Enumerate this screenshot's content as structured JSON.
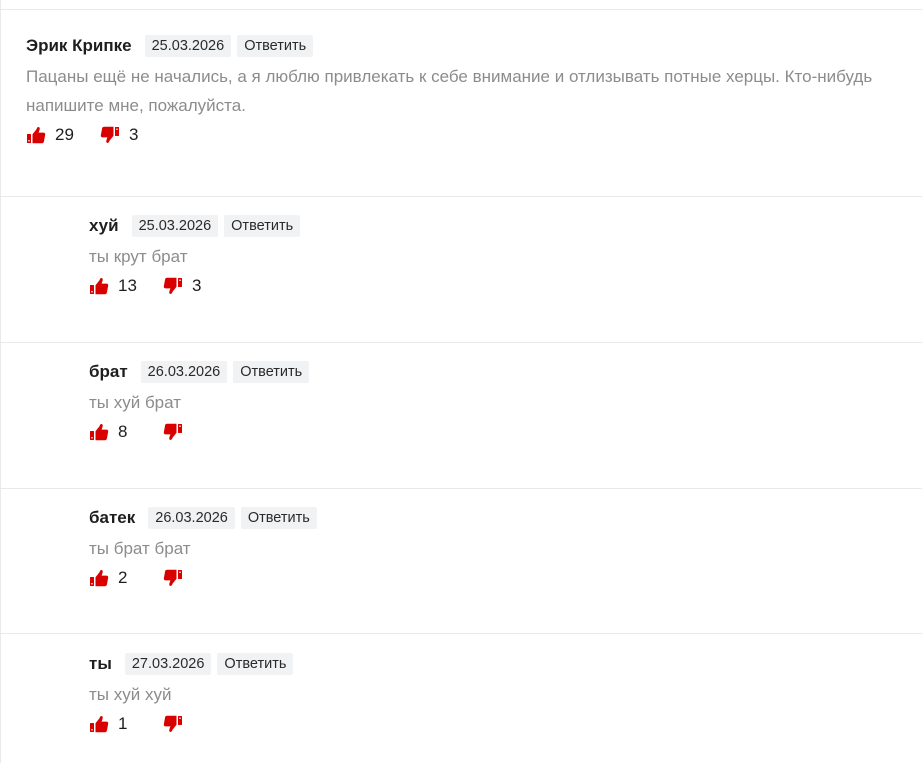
{
  "reply_label": "Ответить",
  "colors": {
    "accent": "#d90000",
    "text_muted": "#8c8c8c",
    "chip_bg": "#f1f2f3"
  },
  "icons": {
    "like": "thumbs-up-icon",
    "dislike": "thumbs-down-icon"
  },
  "comments": [
    {
      "author": "Эрик Крипке",
      "date": "25.03.2026",
      "text_lines": [
        "Пацаны ещё не начались, а я люблю привлекать к себе внимание и отлизывать потные херцы. Кто-нибудь",
        "напишите мне, пожалуйста."
      ],
      "likes": "29",
      "dislikes": "3",
      "level": 0
    },
    {
      "author": "хуй",
      "date": "25.03.2026",
      "text_lines": [
        "ты крут брат"
      ],
      "likes": "13",
      "dislikes": "3",
      "level": 1
    },
    {
      "author": "брат",
      "date": "26.03.2026",
      "text_lines": [
        "ты хуй брат"
      ],
      "likes": "8",
      "dislikes": "",
      "level": 1
    },
    {
      "author": "батек",
      "date": "26.03.2026",
      "text_lines": [
        "ты брат брат"
      ],
      "likes": "2",
      "dislikes": "",
      "level": 1
    },
    {
      "author": "ты",
      "date": "27.03.2026",
      "text_lines": [
        "ты хуй хуй"
      ],
      "likes": "1",
      "dislikes": "",
      "level": 1
    }
  ]
}
